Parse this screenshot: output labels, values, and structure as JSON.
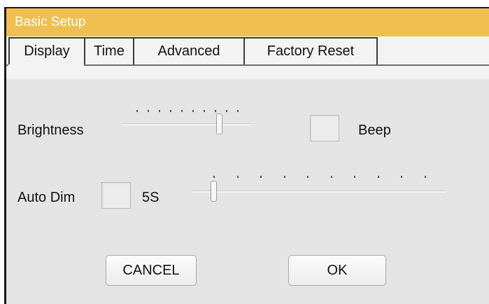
{
  "window": {
    "title": "Basic Setup",
    "accent_color": "#f0bf4f"
  },
  "tabs": [
    {
      "label": "Display",
      "active": true
    },
    {
      "label": "Time",
      "active": false
    },
    {
      "label": "Advanced",
      "active": false
    },
    {
      "label": "Factory Reset",
      "active": false
    }
  ],
  "display": {
    "brightness": {
      "label": "Brightness",
      "value_fraction": 0.82,
      "tick_count": 10
    },
    "beep": {
      "label": "Beep",
      "checked": false
    },
    "auto_dim": {
      "label": "Auto Dim",
      "checked": false,
      "value_label": "5S",
      "value_fraction": 0.0,
      "tick_count": 10
    }
  },
  "buttons": {
    "cancel": "CANCEL",
    "ok": "OK"
  }
}
